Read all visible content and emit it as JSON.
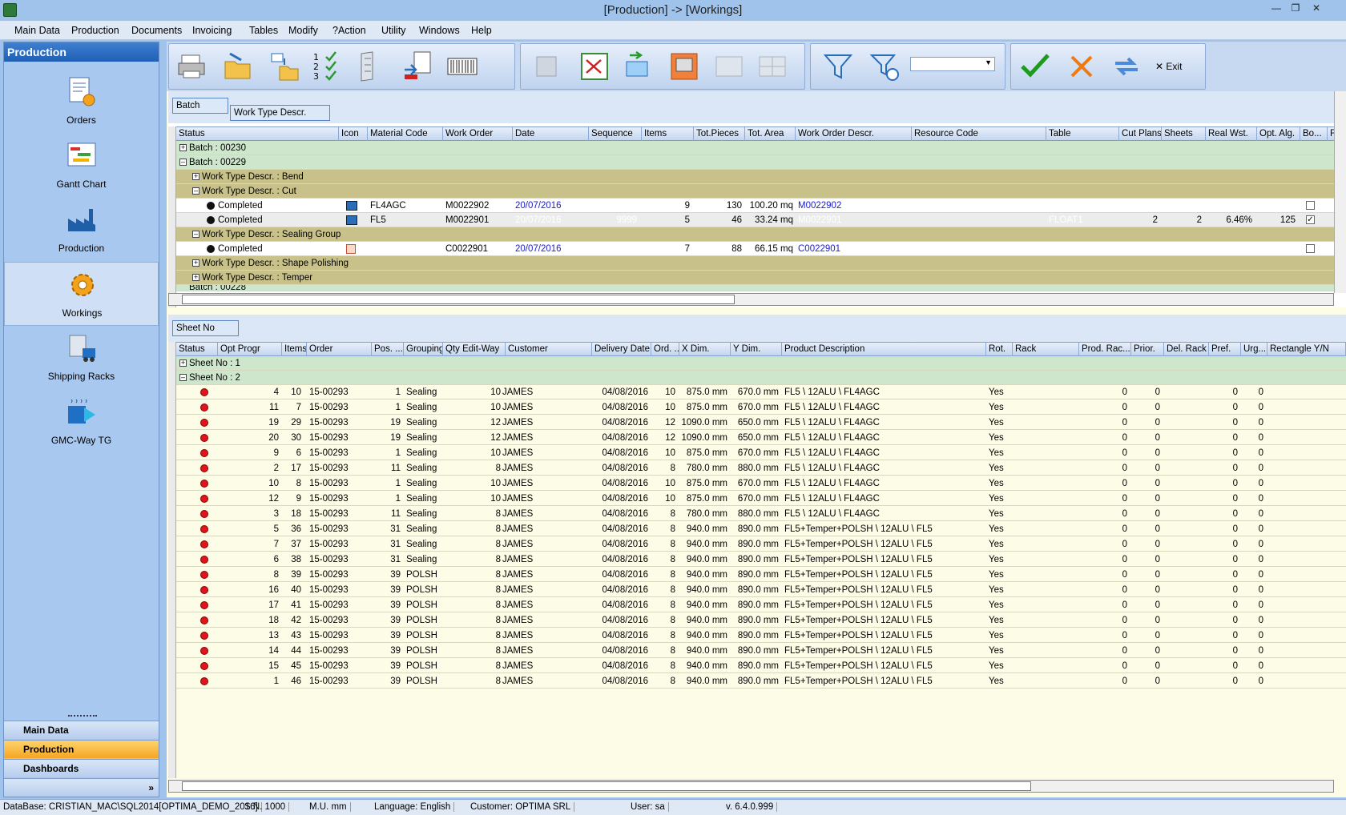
{
  "window": {
    "title": "[Production] -> [Workings]"
  },
  "menu": [
    "Main Data",
    "Production",
    "Documents",
    "Invoicing",
    "Tables",
    "Modify",
    "?Action",
    "Utility",
    "Windows",
    "Help"
  ],
  "sidebar": {
    "title": "Production",
    "items": [
      {
        "label": "Orders",
        "icon": "orders-icon"
      },
      {
        "label": "Gantt Chart",
        "icon": "gantt-chart-icon"
      },
      {
        "label": "Production",
        "icon": "factory-icon"
      },
      {
        "label": "Workings",
        "icon": "gear-icon"
      },
      {
        "label": "Shipping Racks",
        "icon": "shipping-rack-icon"
      },
      {
        "label": "GMC-Way TG",
        "icon": "gmc-way-icon"
      }
    ],
    "nav": [
      "Main Data",
      "Production",
      "Dashboards"
    ]
  },
  "toolbar": {
    "exit_label": "Exit"
  },
  "grid1": {
    "group_by": [
      "Batch",
      "Work Type Descr."
    ],
    "columns": [
      "Status",
      "Icon",
      "Material Code",
      "Work Order",
      "Date",
      "Sequence",
      "Items",
      "Tot.Pieces",
      "Tot. Area",
      "Work Order Descr.",
      "Resource Code",
      "Table",
      "Cut Plans",
      "Sheets",
      "Real Wst.",
      "Opt. Alg.",
      "Bo...",
      "F"
    ],
    "groups": {
      "batch1": "Batch : 00230",
      "batch2": "Batch : 00229",
      "wt_bend": "Work Type Descr. : Bend",
      "wt_cut": "Work Type Descr. : Cut",
      "wt_seal": "Work Type Descr. : Sealing Group",
      "wt_shape": "Work Type Descr. : Shape Polishing",
      "wt_temper": "Work Type Descr. : Temper",
      "batch3": "Batch : 00228"
    },
    "rows": [
      {
        "status": "Completed",
        "material": "FL4AGC",
        "order": "M0022902",
        "date": "20/07/2016",
        "sequence": "",
        "items": "9",
        "pieces": "130",
        "area": "100.20 mq",
        "descr": "M0022902",
        "resource": "",
        "table": "",
        "cutplans": "",
        "sheets": "",
        "wst": "",
        "alg": "",
        "bo": false
      },
      {
        "status": "Completed",
        "material": "FL5",
        "order": "M0022901",
        "date": "20/07/2016",
        "sequence": "9999",
        "items": "5",
        "pieces": "46",
        "area": "33.24 mq",
        "descr": "M0022901",
        "resource": "",
        "table": "FLOAT1",
        "cutplans": "2",
        "sheets": "2",
        "wst": "6.46%",
        "alg": "125",
        "bo": true
      },
      {
        "status": "Completed",
        "material": "",
        "order": "C0022901",
        "date": "20/07/2016",
        "sequence": "",
        "items": "7",
        "pieces": "88",
        "area": "66.15 mq",
        "descr": "C0022901",
        "resource": "",
        "table": "",
        "cutplans": "",
        "sheets": "",
        "wst": "",
        "alg": "",
        "bo": false
      }
    ]
  },
  "grid2": {
    "group_by": "Sheet No",
    "columns": [
      "Status",
      "Opt Progr",
      "Items",
      "Order",
      "Pos. ...",
      "Grouping",
      "Qty Edit-Way",
      "Customer",
      "Delivery Date",
      "Ord. ...",
      "X Dim.",
      "Y Dim.",
      "Product Description",
      "Rot.",
      "Rack",
      "Prod. Rac...",
      "Prior.",
      "Del. Rack",
      "Pref.",
      "Urg...",
      "Rectangle Y/N"
    ],
    "groups": [
      "Sheet No : 1",
      "Sheet No : 2"
    ],
    "rows": [
      [
        "4",
        "10",
        "15-00293",
        "1",
        "Sealing",
        "10",
        "JAMES",
        "04/08/2016",
        "10",
        "875.0 mm",
        "670.0 mm",
        "FL5 \\ 12ALU \\ FL4AGC",
        "Yes",
        "",
        "0",
        "0",
        "",
        "0",
        "0"
      ],
      [
        "11",
        "7",
        "15-00293",
        "1",
        "Sealing",
        "10",
        "JAMES",
        "04/08/2016",
        "10",
        "875.0 mm",
        "670.0 mm",
        "FL5 \\ 12ALU \\ FL4AGC",
        "Yes",
        "",
        "0",
        "0",
        "",
        "0",
        "0"
      ],
      [
        "19",
        "29",
        "15-00293",
        "19",
        "Sealing",
        "12",
        "JAMES",
        "04/08/2016",
        "12",
        "1090.0 mm",
        "650.0 mm",
        "FL5 \\ 12ALU \\ FL4AGC",
        "Yes",
        "",
        "0",
        "0",
        "",
        "0",
        "0"
      ],
      [
        "20",
        "30",
        "15-00293",
        "19",
        "Sealing",
        "12",
        "JAMES",
        "04/08/2016",
        "12",
        "1090.0 mm",
        "650.0 mm",
        "FL5 \\ 12ALU \\ FL4AGC",
        "Yes",
        "",
        "0",
        "0",
        "",
        "0",
        "0"
      ],
      [
        "9",
        "6",
        "15-00293",
        "1",
        "Sealing",
        "10",
        "JAMES",
        "04/08/2016",
        "10",
        "875.0 mm",
        "670.0 mm",
        "FL5 \\ 12ALU \\ FL4AGC",
        "Yes",
        "",
        "0",
        "0",
        "",
        "0",
        "0"
      ],
      [
        "2",
        "17",
        "15-00293",
        "11",
        "Sealing",
        "8",
        "JAMES",
        "04/08/2016",
        "8",
        "780.0 mm",
        "880.0 mm",
        "FL5 \\ 12ALU \\ FL4AGC",
        "Yes",
        "",
        "0",
        "0",
        "",
        "0",
        "0"
      ],
      [
        "10",
        "8",
        "15-00293",
        "1",
        "Sealing",
        "10",
        "JAMES",
        "04/08/2016",
        "10",
        "875.0 mm",
        "670.0 mm",
        "FL5 \\ 12ALU \\ FL4AGC",
        "Yes",
        "",
        "0",
        "0",
        "",
        "0",
        "0"
      ],
      [
        "12",
        "9",
        "15-00293",
        "1",
        "Sealing",
        "10",
        "JAMES",
        "04/08/2016",
        "10",
        "875.0 mm",
        "670.0 mm",
        "FL5 \\ 12ALU \\ FL4AGC",
        "Yes",
        "",
        "0",
        "0",
        "",
        "0",
        "0"
      ],
      [
        "3",
        "18",
        "15-00293",
        "11",
        "Sealing",
        "8",
        "JAMES",
        "04/08/2016",
        "8",
        "780.0 mm",
        "880.0 mm",
        "FL5 \\ 12ALU \\ FL4AGC",
        "Yes",
        "",
        "0",
        "0",
        "",
        "0",
        "0"
      ],
      [
        "5",
        "36",
        "15-00293",
        "31",
        "Sealing",
        "8",
        "JAMES",
        "04/08/2016",
        "8",
        "940.0 mm",
        "890.0 mm",
        "FL5+Temper+POLSH \\ 12ALU \\ FL5",
        "Yes",
        "",
        "0",
        "0",
        "",
        "0",
        "0"
      ],
      [
        "7",
        "37",
        "15-00293",
        "31",
        "Sealing",
        "8",
        "JAMES",
        "04/08/2016",
        "8",
        "940.0 mm",
        "890.0 mm",
        "FL5+Temper+POLSH \\ 12ALU \\ FL5",
        "Yes",
        "",
        "0",
        "0",
        "",
        "0",
        "0"
      ],
      [
        "6",
        "38",
        "15-00293",
        "31",
        "Sealing",
        "8",
        "JAMES",
        "04/08/2016",
        "8",
        "940.0 mm",
        "890.0 mm",
        "FL5+Temper+POLSH \\ 12ALU \\ FL5",
        "Yes",
        "",
        "0",
        "0",
        "",
        "0",
        "0"
      ],
      [
        "8",
        "39",
        "15-00293",
        "39",
        "POLSH",
        "8",
        "JAMES",
        "04/08/2016",
        "8",
        "940.0 mm",
        "890.0 mm",
        "FL5+Temper+POLSH \\ 12ALU \\ FL5",
        "Yes",
        "",
        "0",
        "0",
        "",
        "0",
        "0"
      ],
      [
        "16",
        "40",
        "15-00293",
        "39",
        "POLSH",
        "8",
        "JAMES",
        "04/08/2016",
        "8",
        "940.0 mm",
        "890.0 mm",
        "FL5+Temper+POLSH \\ 12ALU \\ FL5",
        "Yes",
        "",
        "0",
        "0",
        "",
        "0",
        "0"
      ],
      [
        "17",
        "41",
        "15-00293",
        "39",
        "POLSH",
        "8",
        "JAMES",
        "04/08/2016",
        "8",
        "940.0 mm",
        "890.0 mm",
        "FL5+Temper+POLSH \\ 12ALU \\ FL5",
        "Yes",
        "",
        "0",
        "0",
        "",
        "0",
        "0"
      ],
      [
        "18",
        "42",
        "15-00293",
        "39",
        "POLSH",
        "8",
        "JAMES",
        "04/08/2016",
        "8",
        "940.0 mm",
        "890.0 mm",
        "FL5+Temper+POLSH \\ 12ALU \\ FL5",
        "Yes",
        "",
        "0",
        "0",
        "",
        "0",
        "0"
      ],
      [
        "13",
        "43",
        "15-00293",
        "39",
        "POLSH",
        "8",
        "JAMES",
        "04/08/2016",
        "8",
        "940.0 mm",
        "890.0 mm",
        "FL5+Temper+POLSH \\ 12ALU \\ FL5",
        "Yes",
        "",
        "0",
        "0",
        "",
        "0",
        "0"
      ],
      [
        "14",
        "44",
        "15-00293",
        "39",
        "POLSH",
        "8",
        "JAMES",
        "04/08/2016",
        "8",
        "940.0 mm",
        "890.0 mm",
        "FL5+Temper+POLSH \\ 12ALU \\ FL5",
        "Yes",
        "",
        "0",
        "0",
        "",
        "0",
        "0"
      ],
      [
        "15",
        "45",
        "15-00293",
        "39",
        "POLSH",
        "8",
        "JAMES",
        "04/08/2016",
        "8",
        "940.0 mm",
        "890.0 mm",
        "FL5+Temper+POLSH \\ 12ALU \\ FL5",
        "Yes",
        "",
        "0",
        "0",
        "",
        "0",
        "0"
      ],
      [
        "1",
        "46",
        "15-00293",
        "39",
        "POLSH",
        "8",
        "JAMES",
        "04/08/2016",
        "8",
        "940.0 mm",
        "890.0 mm",
        "FL5+Temper+POLSH \\ 12ALU \\ FL5",
        "Yes",
        "",
        "0",
        "0",
        "",
        "0",
        "0"
      ]
    ]
  },
  "statusbar": {
    "database": "DataBase: CRISTIAN_MAC\\SQL2014[OPTIMA_DEMO_2016]",
    "sn": "S.N. 1000",
    "mu": "M.U. mm",
    "language": "Language: English",
    "customer": "Customer: OPTIMA SRL",
    "user": "User: sa",
    "version": "v. 6.4.0.999"
  },
  "colors": {
    "group_green": "#cde6cc",
    "group_olive": "#c8c28a",
    "row_bg": "#fdfce6",
    "accent_red": "#e0141c",
    "link_blue": "#2020cc"
  }
}
